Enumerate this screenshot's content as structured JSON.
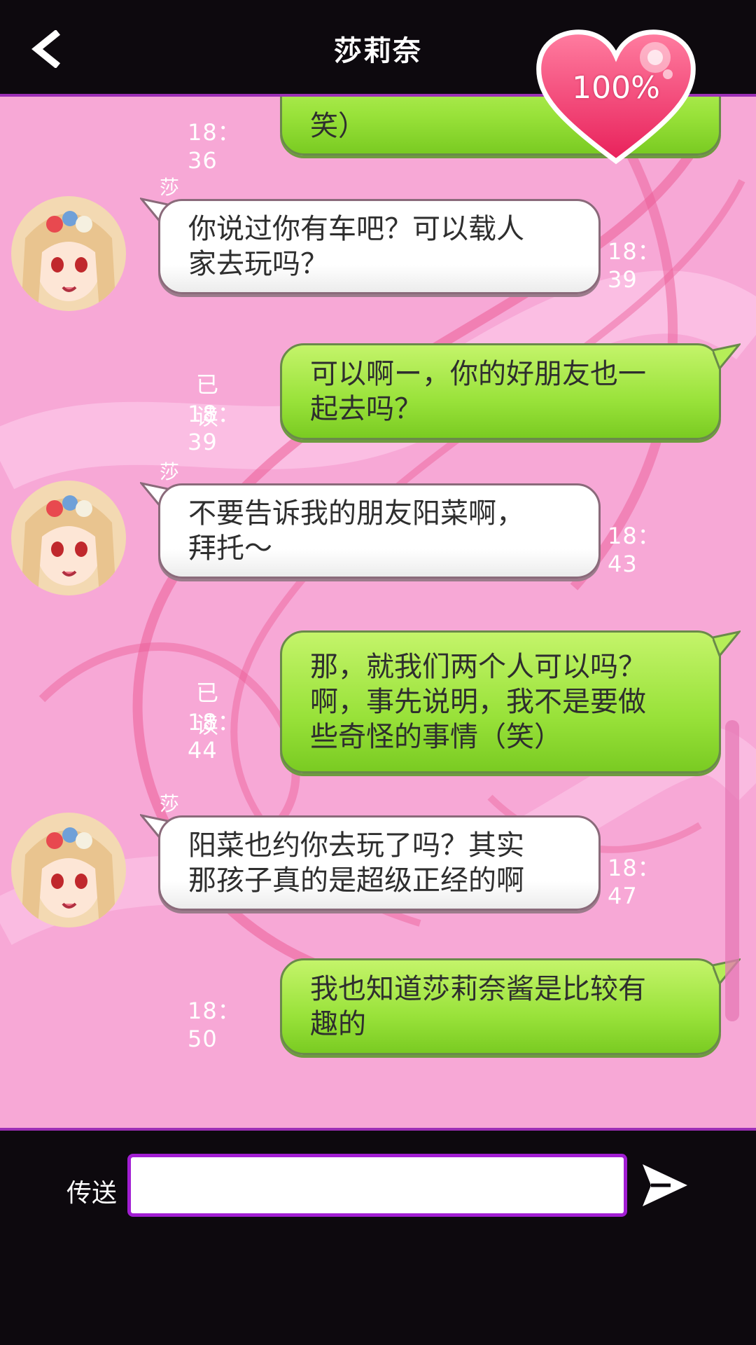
{
  "header": {
    "title": "莎莉奈",
    "back_icon": "chevron-left-icon"
  },
  "affection": {
    "value": "100%",
    "level_percent": 100,
    "icon": "heart-icon",
    "color": "#ef3f72"
  },
  "colors": {
    "chat_background": "#f7a8d6",
    "outgoing_bubble": "#99e23a",
    "incoming_bubble": "#ffffff",
    "accent": "#a21ed3",
    "bar_background": "#0d090e"
  },
  "messages": [
    {
      "direction": "out",
      "text": "笑）",
      "time": "18：36",
      "read_label": ""
    },
    {
      "direction": "in",
      "sender": "莎莉奈",
      "text": "你说过你有车吧？可以载人\n家去玩吗？",
      "time": "18：39"
    },
    {
      "direction": "out",
      "text": "可以啊ー，你的好朋友也一\n起去吗？",
      "time": "18：39",
      "read_label": "已读"
    },
    {
      "direction": "in",
      "sender": "莎莉奈",
      "text": "不要告诉我的朋友阳菜啊，\n拜托～",
      "time": "18：43"
    },
    {
      "direction": "out",
      "text": "那，就我们两个人可以吗？\n啊，事先说明，我不是要做\n些奇怪的事情（笑）",
      "time": "18：44",
      "read_label": "已读"
    },
    {
      "direction": "in",
      "sender": "莎莉奈",
      "text": "阳菜也约你去玩了吗？其实\n那孩子真的是超级正经的啊",
      "time": "18：47"
    },
    {
      "direction": "out",
      "text": "我也知道莎莉奈酱是比较有\n趣的",
      "time": "18：50",
      "read_label": ""
    }
  ],
  "footer": {
    "send_label": "传送",
    "input_value": "",
    "input_placeholder": "",
    "send_icon": "paper-plane-icon"
  }
}
